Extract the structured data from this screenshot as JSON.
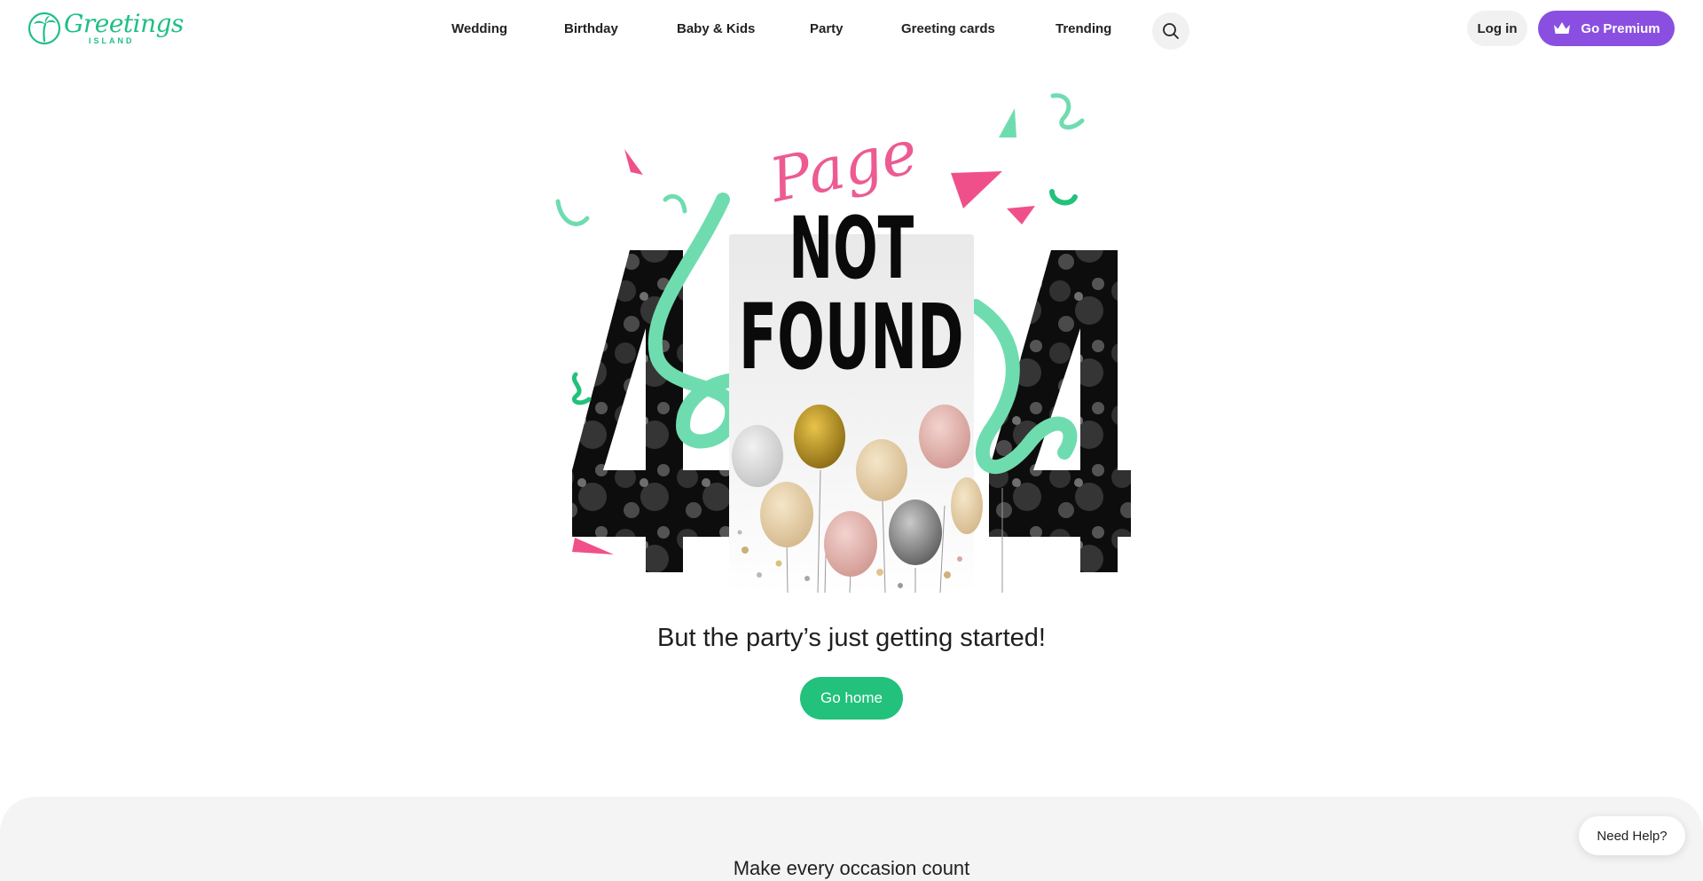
{
  "brand": {
    "name": "Greetings",
    "sub": "ISLAND",
    "color": "#1fbf86"
  },
  "nav": {
    "items": [
      {
        "label": "Wedding"
      },
      {
        "label": "Birthday"
      },
      {
        "label": "Baby & Kids"
      },
      {
        "label": "Party"
      },
      {
        "label": "Greeting cards"
      },
      {
        "label": "Trending"
      }
    ],
    "search_icon": "search-icon"
  },
  "account": {
    "login_label": "Log in",
    "premium_label": "Go Premium",
    "premium_icon": "crown-icon",
    "premium_color": "#8a4fe0"
  },
  "hero": {
    "script_word": "Page",
    "headline_line1": "NOT",
    "headline_line2": "FOUND",
    "digit_left": "4",
    "digit_right": "4",
    "tagline": "But the party’s just getting started!",
    "home_label": "Go home",
    "accent_pink": "#f0508a",
    "accent_mint": "#6fdcb0",
    "button_color": "#22c17c"
  },
  "footer": {
    "band_title": "Make every occasion count",
    "help_label": "Need Help?"
  }
}
